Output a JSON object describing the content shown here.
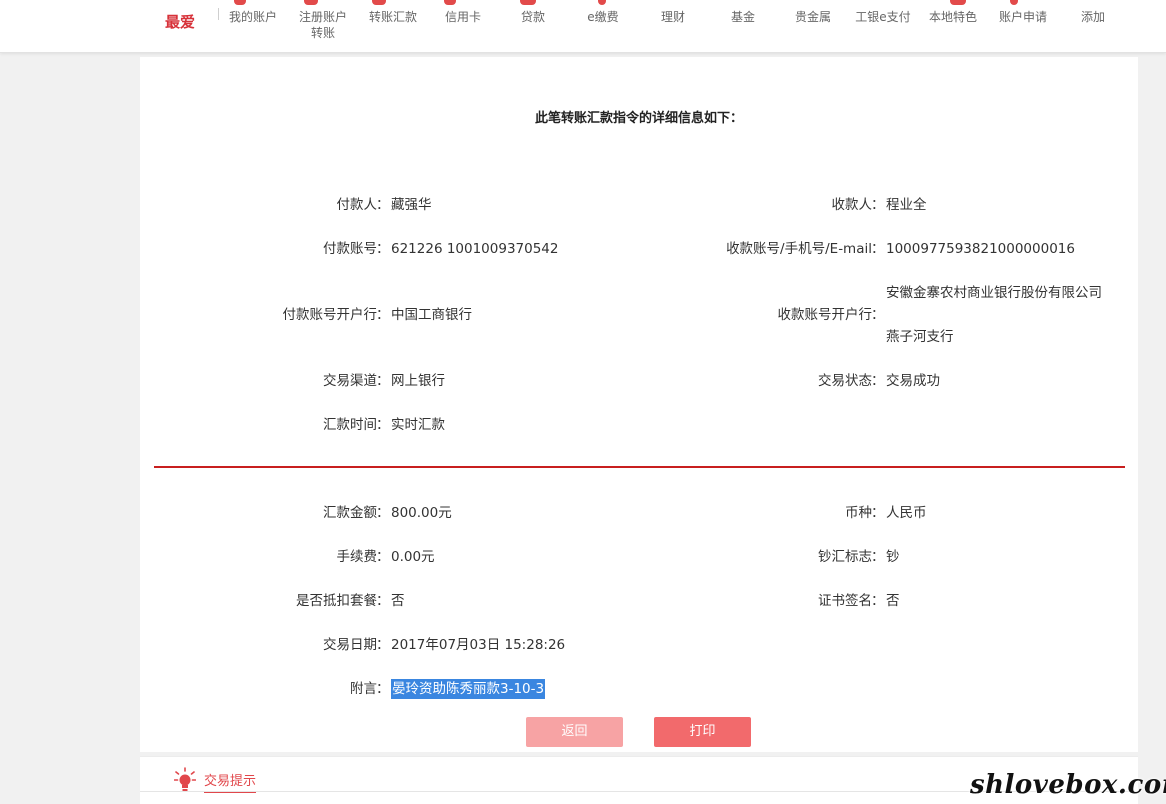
{
  "nav": {
    "favorite": "最爱",
    "items": [
      {
        "label": "我的账户"
      },
      {
        "label": "注册账户\n转账"
      },
      {
        "label": "转账汇款"
      },
      {
        "label": "信用卡"
      },
      {
        "label": "贷款"
      },
      {
        "label": "e缴费"
      },
      {
        "label": "理财"
      },
      {
        "label": "基金"
      },
      {
        "label": "贵金属"
      },
      {
        "label": "工银e支付"
      },
      {
        "label": "本地特色"
      },
      {
        "label": "账户申请"
      },
      {
        "label": "添加"
      }
    ]
  },
  "detail": {
    "title": "此笔转账汇款指令的详细信息如下：",
    "payer_label": "付款人",
    "payer": "藏强华",
    "payee_label": "收款人",
    "payee": "程业全",
    "payer_account_label": "付款账号",
    "payer_account": "621226 1001009370542",
    "payee_account_label": "收款账号/手机号/E-mail",
    "payee_account": "1000977593821000000016",
    "payer_bank_label": "付款账号开户行",
    "payer_bank": "中国工商银行",
    "payee_bank_label": "收款账号开户行",
    "payee_bank_line1": "安徽金寨农村商业银行股份有限公司",
    "payee_bank_line2": "燕子河支行",
    "channel_label": "交易渠道",
    "channel": "网上银行",
    "status_label": "交易状态",
    "status": "交易成功",
    "remit_time_label": "汇款时间",
    "remit_time": "实时汇款",
    "amount_label": "汇款金额",
    "amount": "800.00元",
    "currency_label": "币种",
    "currency": "人民币",
    "fee_label": "手续费",
    "fee": "0.00元",
    "cash_flag_label": "钞汇标志",
    "cash_flag": "钞",
    "package_label": "是否抵扣套餐",
    "package": "否",
    "cert_label": "证书签名",
    "cert": "否",
    "date_label": "交易日期",
    "date": "2017年07月03日 15:28:26",
    "memo_label": "附言",
    "memo": "晏玲资助陈秀丽款3-10-3",
    "colon": "："
  },
  "buttons": {
    "back": "返回",
    "print": "打印"
  },
  "tips": {
    "label": "交易提示"
  },
  "watermark": "shlovebox.com",
  "colors": {
    "accent": "#d7323a",
    "divider": "#c81f1f",
    "btn_back": "#f7a3a4",
    "btn_print": "#f26a6c",
    "selection": "#3a86e0"
  }
}
